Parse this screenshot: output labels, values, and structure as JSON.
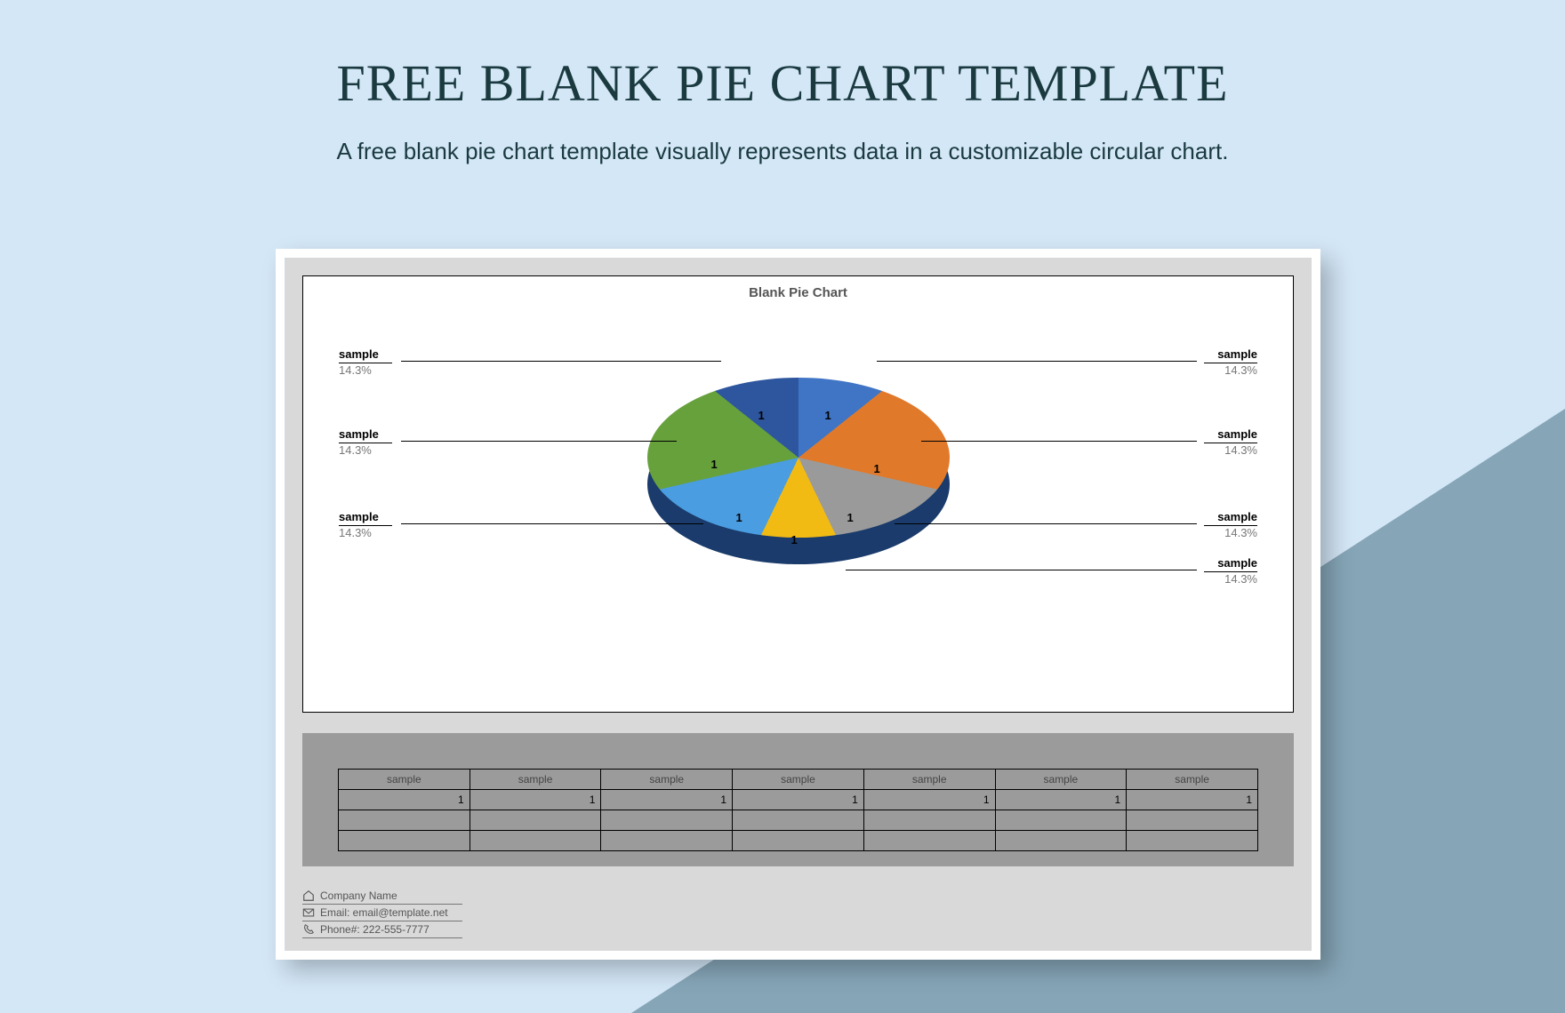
{
  "page": {
    "title": "FREE BLANK PIE CHART TEMPLATE",
    "subtitle": "A free blank pie chart template visually represents data in a customizable circular chart."
  },
  "chart_data": {
    "type": "pie",
    "title": "Blank Pie Chart",
    "series": [
      {
        "name": "sample",
        "value": 1,
        "percent": "14.3%",
        "color": "#3f75c4",
        "data_label": "1"
      },
      {
        "name": "sample",
        "value": 1,
        "percent": "14.3%",
        "color": "#e1792a",
        "data_label": "1"
      },
      {
        "name": "sample",
        "value": 1,
        "percent": "14.3%",
        "color": "#9a9a9a",
        "data_label": "1"
      },
      {
        "name": "sample",
        "value": 1,
        "percent": "14.3%",
        "color": "#f2bb13",
        "data_label": "1"
      },
      {
        "name": "sample",
        "value": 1,
        "percent": "14.3%",
        "color": "#4a9de0",
        "data_label": "1"
      },
      {
        "name": "sample",
        "value": 1,
        "percent": "14.3%",
        "color": "#67a13c",
        "data_label": "1"
      },
      {
        "name": "sample",
        "value": 1,
        "percent": "14.3%",
        "color": "#2d569e",
        "data_label": "1"
      }
    ]
  },
  "table": {
    "headers": [
      "sample",
      "sample",
      "sample",
      "sample",
      "sample",
      "sample",
      "sample"
    ],
    "rows": [
      [
        "1",
        "1",
        "1",
        "1",
        "1",
        "1",
        "1"
      ],
      [
        "",
        "",
        "",
        "",
        "",
        "",
        ""
      ],
      [
        "",
        "",
        "",
        "",
        "",
        "",
        ""
      ]
    ]
  },
  "footer": {
    "company": "Company Name",
    "email_label": "Email: email@template.net",
    "phone_label": "Phone#: 222-555-7777"
  }
}
